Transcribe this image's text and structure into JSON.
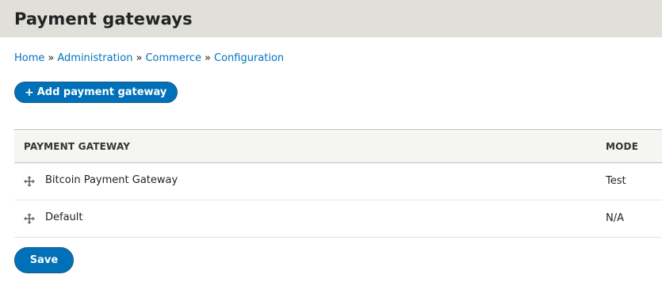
{
  "page": {
    "title": "Payment gateways"
  },
  "breadcrumb": {
    "items": [
      "Home",
      "Administration",
      "Commerce",
      "Configuration"
    ],
    "separator": "»"
  },
  "actions": {
    "add_label": "Add payment gateway",
    "add_icon": "+"
  },
  "table": {
    "columns": [
      "PAYMENT GATEWAY",
      "MODE"
    ],
    "rows": [
      {
        "name": "Bitcoin Payment Gateway",
        "mode": "Test",
        "icon": "drag-handle-icon"
      },
      {
        "name": "Default",
        "mode": "N/A",
        "icon": "drag-handle-icon"
      }
    ]
  },
  "form": {
    "save_label": "Save"
  },
  "colors": {
    "accent": "#0071b8",
    "link": "#0074bd",
    "header_bg": "#e0dfda"
  }
}
